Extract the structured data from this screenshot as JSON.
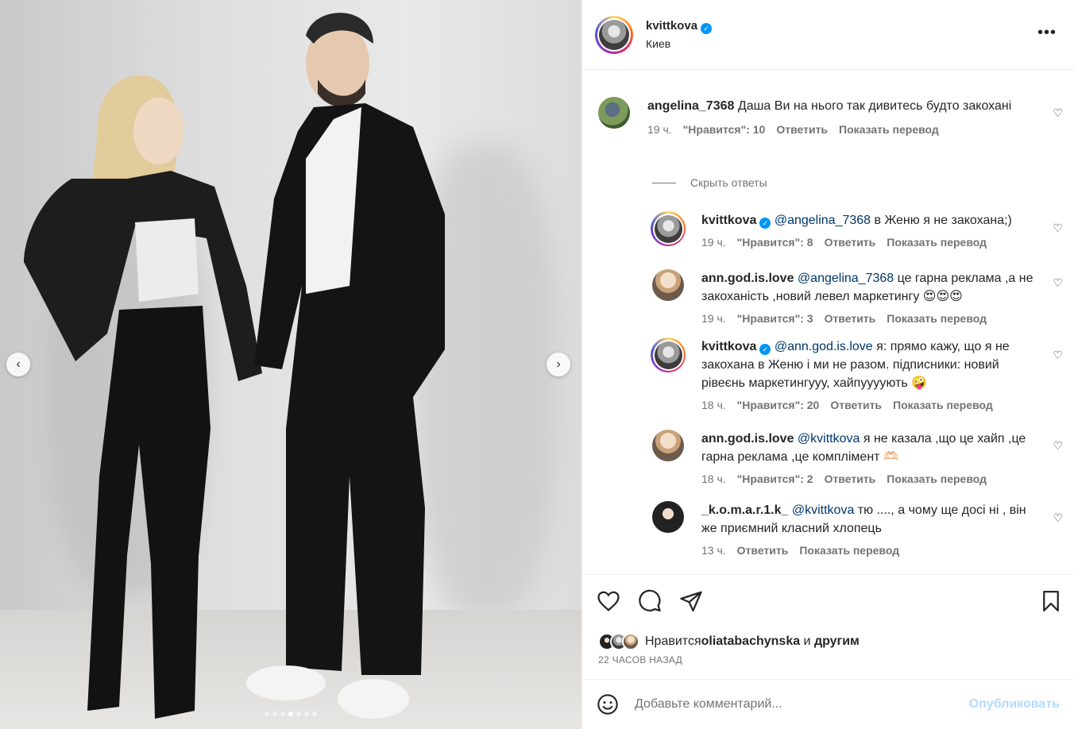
{
  "post": {
    "username": "kvittkova",
    "location": "Киев"
  },
  "comments": [
    {
      "user": "angelina_7368",
      "mention": "",
      "text": "Даша Ви на нього так дивитесь будто закохані",
      "time": "19 ч.",
      "likes": "\"Нравится\": 10",
      "reply": "Ответить",
      "translate": "Показать перевод"
    },
    {
      "user": "kvittkova",
      "mention": "@angelina_7368",
      "text": " в Женю я не закохана;)",
      "time": "19 ч.",
      "likes": "\"Нравится\": 8",
      "reply": "Ответить",
      "translate": "Показать перевод"
    },
    {
      "user": "ann.god.is.love",
      "mention": "@angelina_7368",
      "text": " це гарна реклама ,а не закоханість ,новий левел маркетингу 😍😍😍",
      "time": "19 ч.",
      "likes": "\"Нравится\": 3",
      "reply": "Ответить",
      "translate": "Показать перевод"
    },
    {
      "user": "kvittkova",
      "mention": "@ann.god.is.love",
      "text": " я: прямо кажу, що я не закохана в Женю і ми не разом. підписники: новий рівеєнь маркетингууу, хайпуууують 🤪",
      "time": "18 ч.",
      "likes": "\"Нравится\": 20",
      "reply": "Ответить",
      "translate": "Показать перевод"
    },
    {
      "user": "ann.god.is.love",
      "mention": "@kvittkova",
      "text": " я не казала ,що це хайп ,це гарна реклама ,це комплімент 🫶🏻",
      "time": "18 ч.",
      "likes": "\"Нравится\": 2",
      "reply": "Ответить",
      "translate": "Показать перевод"
    },
    {
      "user": "_k.o.m.a.r.1.k_",
      "mention": "@kvittkova",
      "text": " тю ...., а чому ще досі ні , він же приємний класний хлопець",
      "time": "13 ч.",
      "likes": "",
      "reply": "Ответить",
      "translate": "Показать перевод"
    }
  ],
  "hide_replies": "Скрыть ответы",
  "likes_line": {
    "prefix": "Нравится ",
    "user": "oliatabachynska",
    "middle": " и ",
    "suffix": "другим"
  },
  "timestamp": "22 ЧАСОВ НАЗАД",
  "composer": {
    "placeholder": "Добавьте комментарий...",
    "post": "Опубликовать"
  },
  "icons": {
    "like": "heart-icon",
    "comment": "comment-icon",
    "share": "share-icon",
    "save": "bookmark-icon",
    "more": "more-icon",
    "emoji": "emoji-icon"
  }
}
